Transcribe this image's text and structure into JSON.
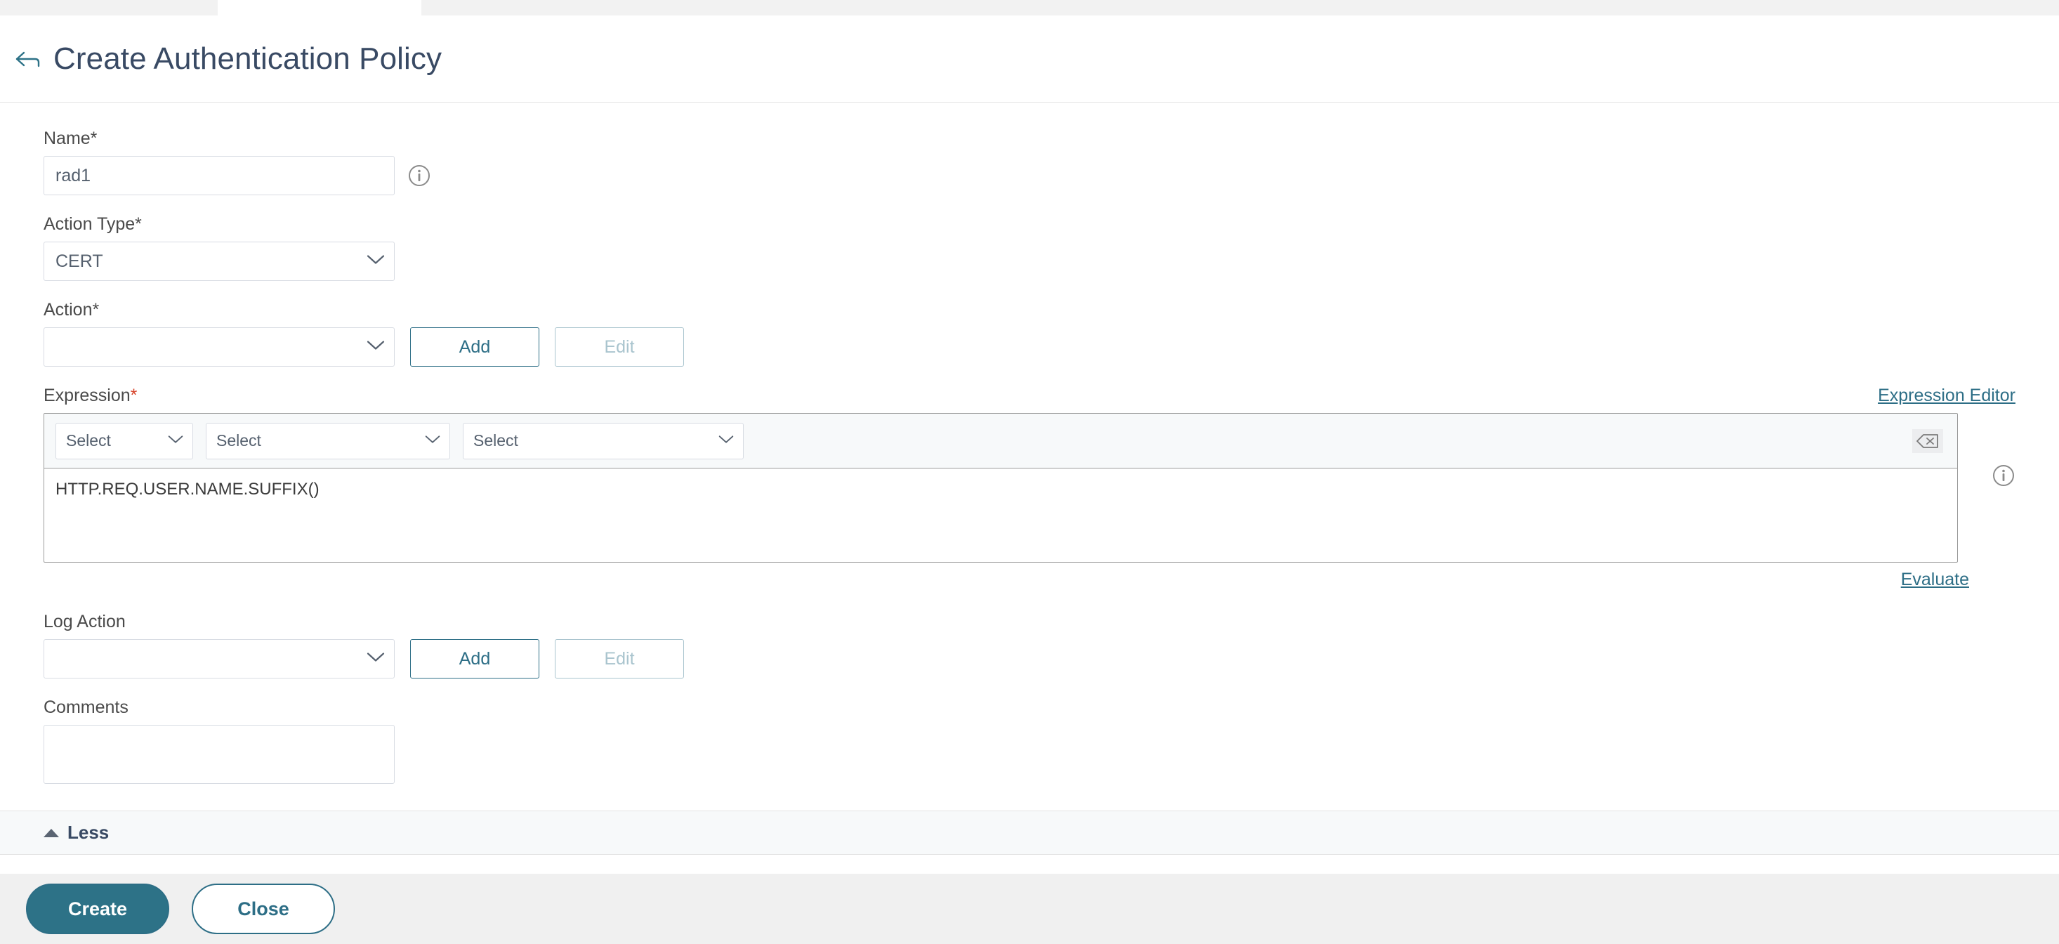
{
  "window": {
    "tabstrip_present": true
  },
  "header": {
    "back_icon": "back-arrow-icon",
    "title": "Create Authentication Policy"
  },
  "form": {
    "name": {
      "label": "Name*",
      "value": "rad1",
      "placeholder": "",
      "info_icon": "info-icon"
    },
    "action_type": {
      "label": "Action Type*",
      "value": "CERT"
    },
    "action": {
      "label": "Action*",
      "value": "",
      "add_label": "Add",
      "edit_label": "Edit"
    },
    "expression": {
      "label": "Expression",
      "required_mark": "*",
      "editor_link": "Expression Editor",
      "selects": [
        {
          "value": "Select"
        },
        {
          "value": "Select"
        },
        {
          "value": "Select"
        }
      ],
      "clear_icon": "backspace-icon",
      "value": "HTTP.REQ.USER.NAME.SUFFIX()",
      "info_icon": "info-icon",
      "evaluate_link": "Evaluate"
    },
    "log_action": {
      "label": "Log Action",
      "value": "",
      "add_label": "Add",
      "edit_label": "Edit"
    },
    "comments": {
      "label": "Comments",
      "value": "",
      "placeholder": ""
    }
  },
  "expander": {
    "label": "Less",
    "caret_icon": "caret-up-icon"
  },
  "footer": {
    "create_label": "Create",
    "close_label": "Close"
  },
  "colors": {
    "accent_teal": "#2d7287",
    "title_navy": "#394a64",
    "required_red": "#d64229",
    "panel_bg": "#ffffff",
    "footer_bg": "#f0f0f0",
    "toolbar_bg": "#f7f9fa"
  }
}
